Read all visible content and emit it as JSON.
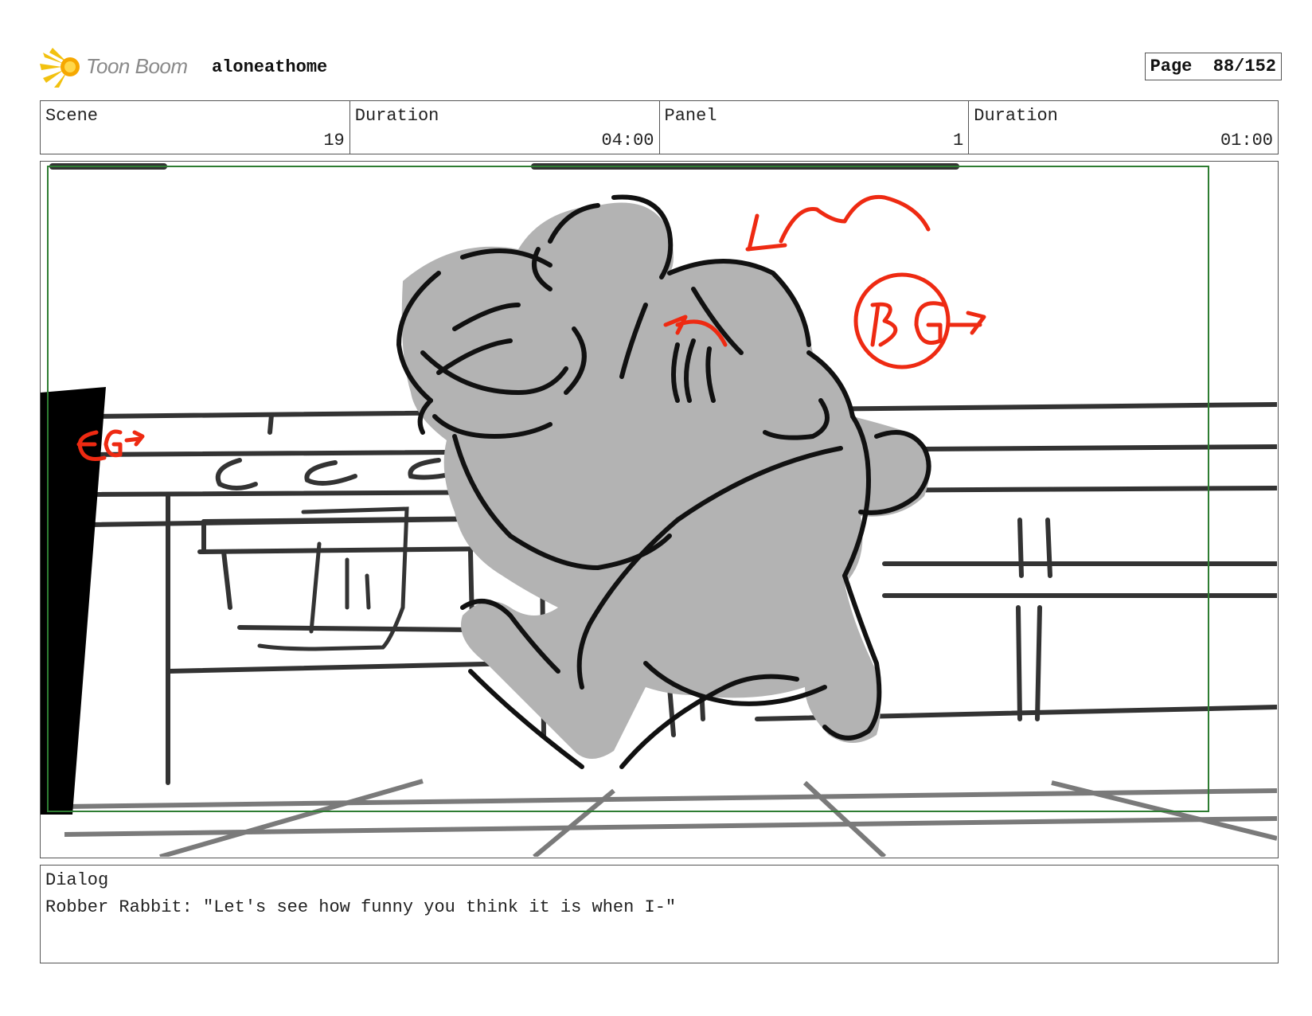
{
  "header": {
    "brand": "Toon Boom",
    "project": "aloneathome",
    "page_label": "Page",
    "page_value": "88/152"
  },
  "info": {
    "scene_label": "Scene",
    "scene_value": "19",
    "scene_duration_label": "Duration",
    "scene_duration_value": "04:00",
    "panel_label": "Panel",
    "panel_value": "1",
    "panel_duration_label": "Duration",
    "panel_duration_value": "01:00"
  },
  "panel_image": {
    "annotations": [
      "BG",
      "BG"
    ],
    "colors": {
      "sketch": "#111111",
      "fill": "#b3b3b3",
      "floor": "#7a7a7a",
      "markup": "#ee2a12",
      "safe_frame": "#2e7d32"
    }
  },
  "dialog": {
    "label": "Dialog",
    "text": "Robber Rabbit: \"Let's see how funny you think it is when I-\""
  }
}
